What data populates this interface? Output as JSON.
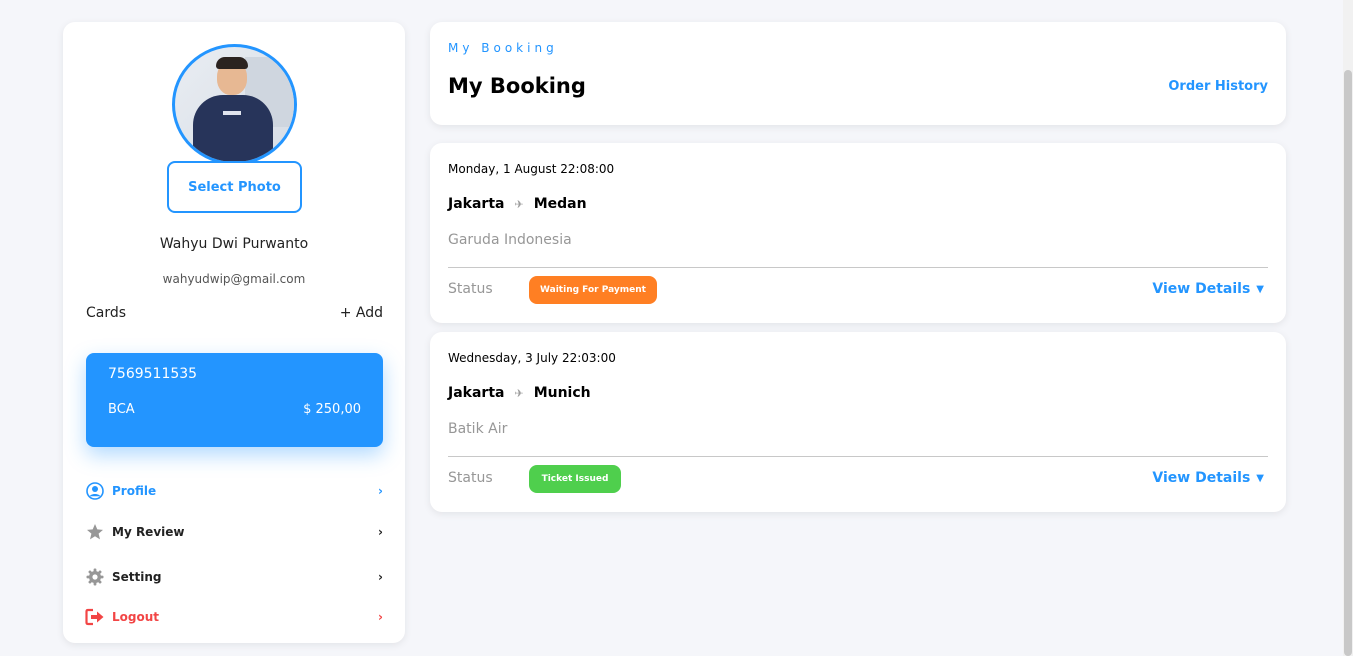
{
  "colors": {
    "accent": "#2395ff",
    "warning": "#ff7f23",
    "success": "#4fcf4d",
    "danger": "#f24545",
    "muted": "#979797"
  },
  "sidebar": {
    "select_photo_label": "Select Photo",
    "user_name": "Wahyu Dwi Purwanto",
    "user_email": "wahyudwip@gmail.com",
    "cards_label": "Cards",
    "add_label": "+ Add",
    "card": {
      "number": "7569511535",
      "bank": "BCA",
      "balance": "$ 250,00"
    },
    "menu": [
      {
        "label": "Profile",
        "icon": "user-circle-icon"
      },
      {
        "label": "My Review",
        "icon": "star-icon"
      },
      {
        "label": "Setting",
        "icon": "gear-icon"
      },
      {
        "label": "Logout",
        "icon": "logout-icon"
      }
    ]
  },
  "header": {
    "kicker": "My Booking",
    "title": "My Booking",
    "order_history": "Order History"
  },
  "bookings": [
    {
      "date": "Monday, 1 August 22:08:00",
      "from": "Jakarta",
      "to": "Medan",
      "airline": "Garuda Indonesia",
      "status_label": "Status",
      "status": "Waiting For Payment",
      "details_label": "View Details"
    },
    {
      "date": "Wednesday, 3 July 22:03:00",
      "from": "Jakarta",
      "to": "Munich",
      "airline": "Batik Air",
      "status_label": "Status",
      "status": "Ticket Issued",
      "details_label": "View Details"
    }
  ]
}
